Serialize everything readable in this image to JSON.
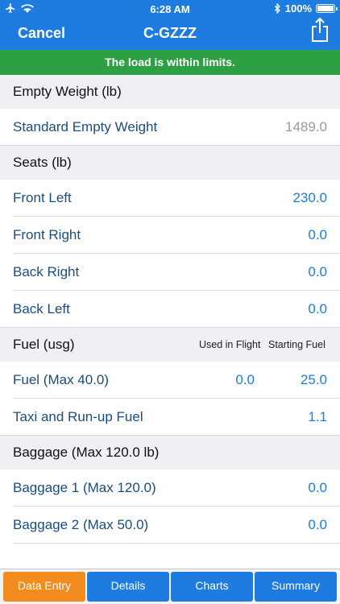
{
  "status": {
    "time": "6:28 AM",
    "battery": "100%"
  },
  "nav": {
    "cancel_label": "Cancel",
    "title": "C-GZZZ"
  },
  "banner": {
    "text": "The load is within limits.",
    "color": "#2ea044"
  },
  "empty_weight": {
    "header": "Empty Weight (lb)",
    "rows": [
      {
        "label": "Standard Empty Weight",
        "value": "1489.0"
      }
    ]
  },
  "seats": {
    "header": "Seats (lb)",
    "rows": [
      {
        "label": "Front Left",
        "value": "230.0"
      },
      {
        "label": "Front Right",
        "value": "0.0"
      },
      {
        "label": "Back Right",
        "value": "0.0"
      },
      {
        "label": "Back Left",
        "value": "0.0"
      }
    ]
  },
  "fuel": {
    "header": "Fuel (usg)",
    "col_used": "Used in Flight",
    "col_starting": "Starting Fuel",
    "rows": [
      {
        "label": "Fuel (Max 40.0)",
        "used": "0.0",
        "value": "25.0"
      },
      {
        "label": "Taxi and Run-up Fuel",
        "value": "1.1"
      }
    ]
  },
  "baggage": {
    "header": "Baggage (Max 120.0 lb)",
    "rows": [
      {
        "label": "Baggage 1 (Max 120.0)",
        "value": "0.0"
      },
      {
        "label": "Baggage 2 (Max 50.0)",
        "value": "0.0"
      }
    ]
  },
  "tabs": [
    {
      "label": "Data Entry",
      "active": true
    },
    {
      "label": "Details"
    },
    {
      "label": "Charts"
    },
    {
      "label": "Summary"
    }
  ],
  "colors": {
    "accent": "#1e7ce0",
    "active_tab": "#f28c1f",
    "ok": "#2ea044"
  }
}
